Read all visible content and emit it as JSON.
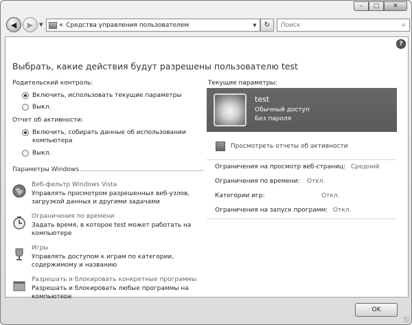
{
  "window": {
    "minimize": "–",
    "maximize": "□",
    "close": "✕"
  },
  "nav": {
    "back_glyph": "◀",
    "forward_glyph": "▶",
    "address_prefix": "«",
    "address": "Средства управления пользователем",
    "search_placeholder": "Поиск",
    "refresh_glyph": "↻"
  },
  "page": {
    "title": "Выбрать, какие действия будут разрешены пользователю test"
  },
  "parental": {
    "label": "Родительский контроль:",
    "options": [
      {
        "label": "Включить, использовать текущие параметры",
        "selected": true
      },
      {
        "label": "Выкл.",
        "selected": false
      }
    ]
  },
  "activity": {
    "label": "Отчет об активности:",
    "options": [
      {
        "label": "Включить, собирать данные об использовании компьютера",
        "selected": true
      },
      {
        "label": "Выкл.",
        "selected": false
      }
    ]
  },
  "windows_settings": {
    "title": "Параметры Windows",
    "items": [
      {
        "icon": "globe-icon",
        "title": "Веб-фильтр Windows Vista",
        "desc": "Управлять просмотром разрешенных веб-узлов, загрузкой данных и другими задачами"
      },
      {
        "icon": "clock-icon",
        "title": "Ограничения по времени",
        "desc": "Задать время, в которое test может работать на компьютере"
      },
      {
        "icon": "trophy-icon",
        "title": "Игры",
        "desc": "Управлять доступом к играм по категории, содержимому и названию"
      },
      {
        "icon": "program-icon",
        "title": "Разрешать и блокировать конкретные программы",
        "desc": "Разрешать и блокировать любые программы на компьютере"
      }
    ]
  },
  "current": {
    "label": "Текущие параметры:",
    "user_name": "test",
    "account_type": "Обычный доступ",
    "password": "Без пароля",
    "report_link": "Просмотреть отчеты об активности",
    "limits": [
      {
        "label": "Ограничения на просмотр веб-страниц:",
        "value": "Средний"
      },
      {
        "label": "Ограничения по времени:",
        "value": "Откл."
      },
      {
        "label": "Категории игр:",
        "value": "Откл."
      },
      {
        "label": "Ограничения на запуск программ:",
        "value": "Откл."
      }
    ]
  },
  "footer": {
    "ok": "OK"
  },
  "help": "?"
}
